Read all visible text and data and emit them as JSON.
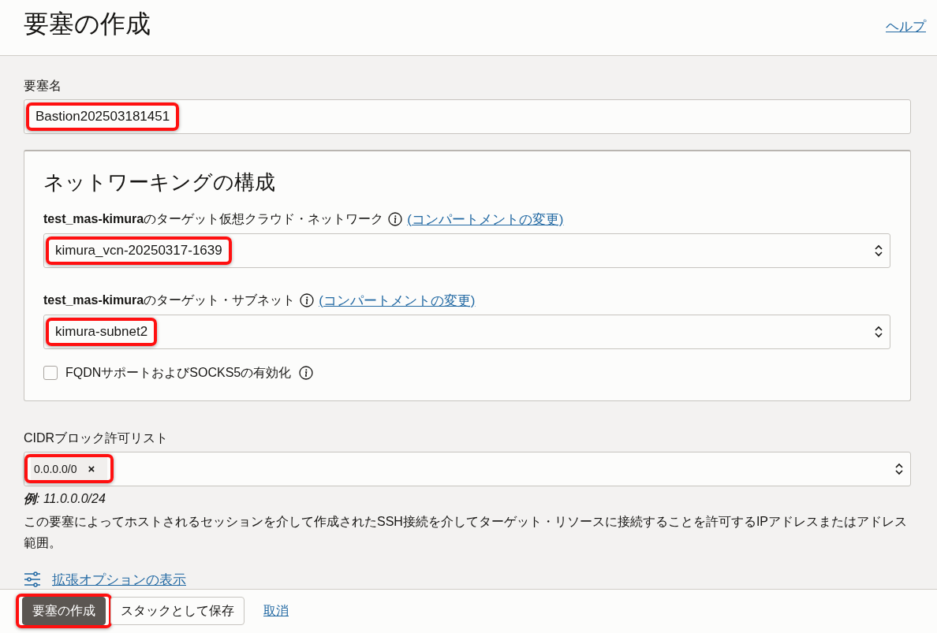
{
  "header": {
    "title": "要塞の作成",
    "help_link": "ヘルプ"
  },
  "name_field": {
    "label": "要塞名",
    "value": "Bastion202503181451",
    "highlighted": true
  },
  "networking": {
    "title": "ネットワーキングの構成",
    "fields": [
      {
        "label_bold": "test_mas-kimura",
        "label_rest": "のターゲット仮想クラウド・ネットワーク",
        "link": "(コンパートメントの変更)",
        "value": "kimura_vcn-20250317-1639",
        "highlighted": true
      },
      {
        "label_bold": "test_mas-kimura",
        "label_rest": "のターゲット・サブネット",
        "link": "(コンパートメントの変更)",
        "value": "kimura-subnet2",
        "highlighted": true
      }
    ],
    "checkbox": {
      "label": "FQDNサポートおよびSOCKS5の有効化",
      "checked": false
    }
  },
  "cidr": {
    "label": "CIDRブロック許可リスト",
    "tags": [
      {
        "text": "0.0.0.0/0",
        "remove": "×"
      }
    ],
    "highlighted": true,
    "example_label": "例",
    "example_value": ": 11.0.0.0/24",
    "description": "この要塞によってホストされるセッションを介して作成されたSSH接続を介してターゲット・リソースに接続することを許可するIPアドレスまたはアドレス範囲。"
  },
  "advanced_link": "拡張オプションの表示",
  "footer": {
    "buttons": [
      {
        "label": "要塞の作成",
        "kind": "primary",
        "highlighted": true
      },
      {
        "label": "スタックとして保存",
        "kind": "secondary",
        "highlighted": false
      },
      {
        "label": "取消",
        "kind": "link",
        "highlighted": false
      }
    ]
  }
}
